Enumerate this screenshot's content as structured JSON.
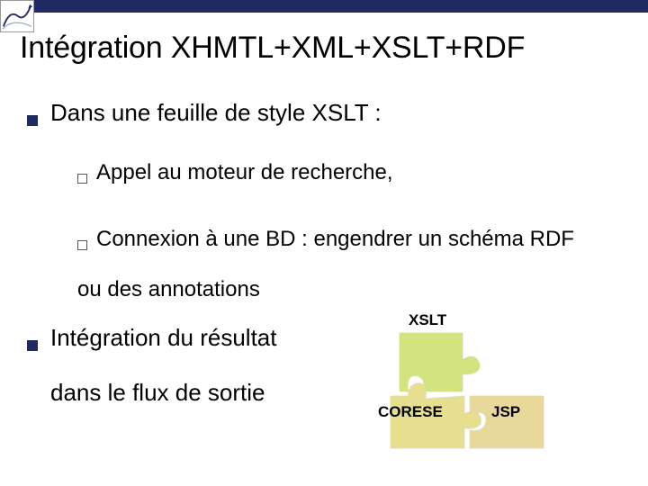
{
  "slide": {
    "title": "Intégration XHMTL+XML+XSLT+RDF",
    "bullet1": "Dans une feuille de style XSLT :",
    "sub1_prefix": "Appel",
    "sub1_rest": " au moteur de recherche,",
    "sub2_prefix": "Connexion",
    "sub2_rest": " à une BD : engendrer un schéma RDF",
    "sub2_tail": "ou des annotations",
    "bullet2": "Intégration du résultat",
    "bullet2_tail": "dans le flux de sortie",
    "diagram": {
      "xslt": "XSLT",
      "corese": "CORESE",
      "jsp": "JSP"
    },
    "colors": {
      "xslt": "#d3e37f",
      "corese": "#e6df8f",
      "jsp": "#e8d89a"
    }
  }
}
